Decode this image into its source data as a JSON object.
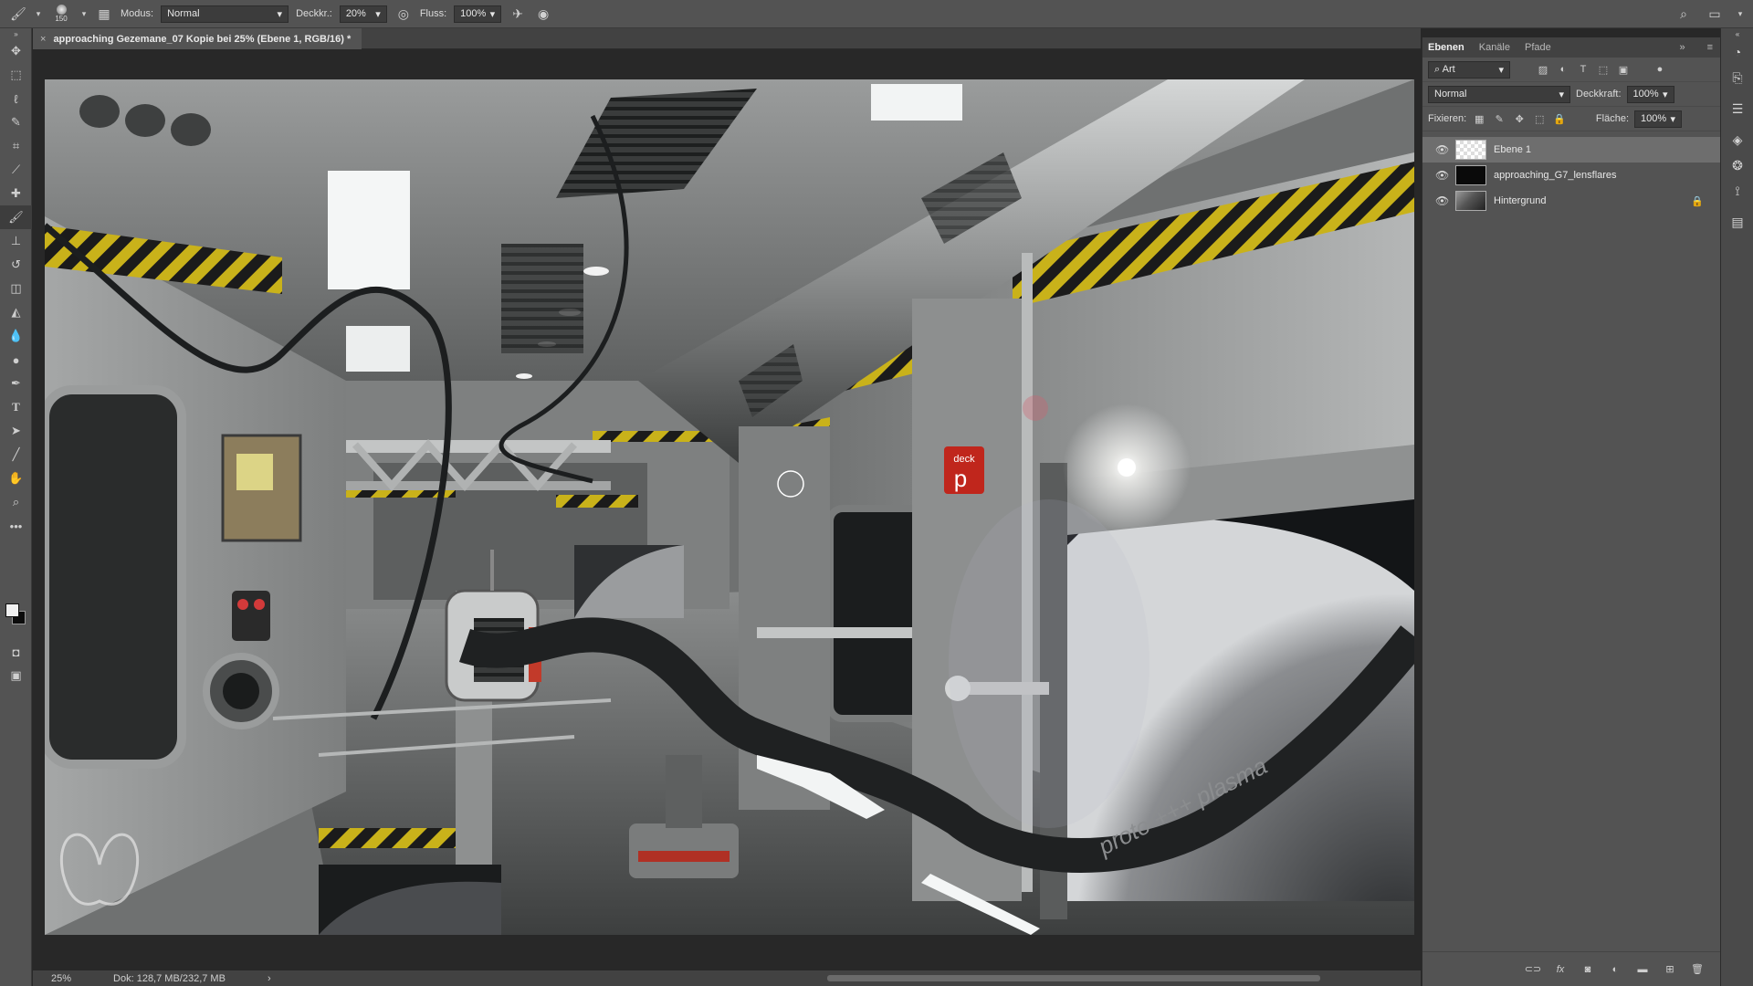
{
  "options_bar": {
    "brush_size": "150",
    "mode_label": "Modus:",
    "mode_value": "Normal",
    "opacity_label": "Deckkr.:",
    "opacity_value": "20%",
    "flow_label": "Fluss:",
    "flow_value": "100%"
  },
  "document_tab": {
    "title": "approaching Gezemane_07 Kopie bei 25% (Ebene 1, RGB/16) *"
  },
  "canvas": {
    "deck_sign_top": "deck",
    "deck_sign_letter": "p",
    "hose_text": "proto +++ plasma"
  },
  "status_bar": {
    "zoom": "25%",
    "doc_info": "Dok: 128,7 MB/232,7 MB"
  },
  "layers_panel": {
    "tabs": [
      "Ebenen",
      "Kanäle",
      "Pfade"
    ],
    "filter_label": "Art",
    "blend_mode": "Normal",
    "opacity_label": "Deckkraft:",
    "opacity_value": "100%",
    "lock_label": "Fixieren:",
    "fill_label": "Fläche:",
    "fill_value": "100%",
    "layers": [
      {
        "name": "Ebene 1"
      },
      {
        "name": "approaching_G7_lensflares"
      },
      {
        "name": "Hintergrund"
      }
    ]
  },
  "colors": {
    "ui_bg": "#535353",
    "ui_dark": "#282828",
    "hazard_yellow": "#c9b21a",
    "deck_sign_red": "#c0261c"
  }
}
